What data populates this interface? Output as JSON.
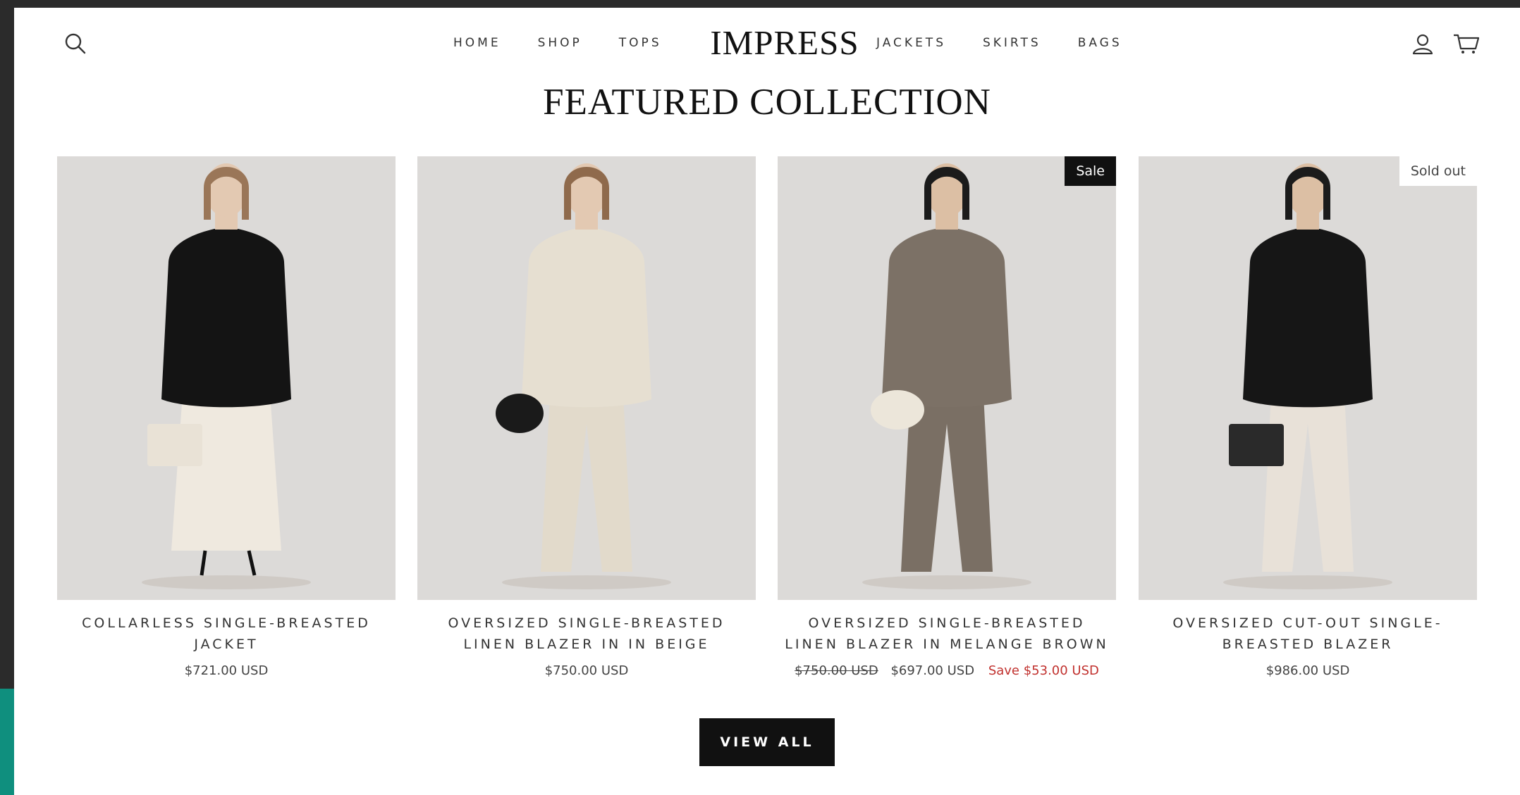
{
  "brand": {
    "logo": "IMPRESS"
  },
  "nav": {
    "left": [
      "HOME",
      "SHOP",
      "TOPS"
    ],
    "right": [
      "JACKETS",
      "SKIRTS",
      "BAGS"
    ]
  },
  "icons": {
    "search": "search-icon",
    "account": "user-icon",
    "cart": "cart-icon"
  },
  "section": {
    "title": "FEATURED COLLECTION"
  },
  "products": [
    {
      "title": "COLLARLESS SINGLE-BREASTED JACKET",
      "price": "$721.00 USD",
      "badge": "",
      "outfit": {
        "jacket": "#141414",
        "bottom": "#efe9df",
        "bag": "#e9e2d6",
        "skin": "#e3c9b2",
        "hair": "#9a7658"
      }
    },
    {
      "title": "OVERSIZED SINGLE-BREASTED LINEN BLAZER IN IN BEIGE",
      "price": "$750.00 USD",
      "badge": "",
      "outfit": {
        "jacket": "#e6dfd1",
        "bottom": "#e2dacb",
        "bag": "#1a1a1a",
        "skin": "#e3c9b2",
        "hair": "#8f6a4c"
      }
    },
    {
      "title": "OVERSIZED SINGLE-BREASTED LINEN BLAZER IN MELANGE BROWN",
      "compare_price": "$750.00 USD",
      "price": "$697.00 USD",
      "save": "Save $53.00 USD",
      "badge": "Sale",
      "outfit": {
        "jacket": "#7c7166",
        "bottom": "#7a6f64",
        "bag": "#ece6da",
        "skin": "#dcbfa4",
        "hair": "#1b1b1b"
      }
    },
    {
      "title": "OVERSIZED CUT-OUT SINGLE-BREASTED BLAZER",
      "price": "$986.00 USD",
      "badge": "Sold out",
      "outfit": {
        "jacket": "#161616",
        "bottom": "#e8e1d8",
        "bag": "#2a2a2a",
        "skin": "#dcbfa4",
        "hair": "#1b1b1b"
      }
    }
  ],
  "cta": {
    "view_all": "VIEW ALL"
  },
  "colors": {
    "accent": "#0f8f7e",
    "sale_text": "#c1312e",
    "frame": "#2b2b2b"
  }
}
